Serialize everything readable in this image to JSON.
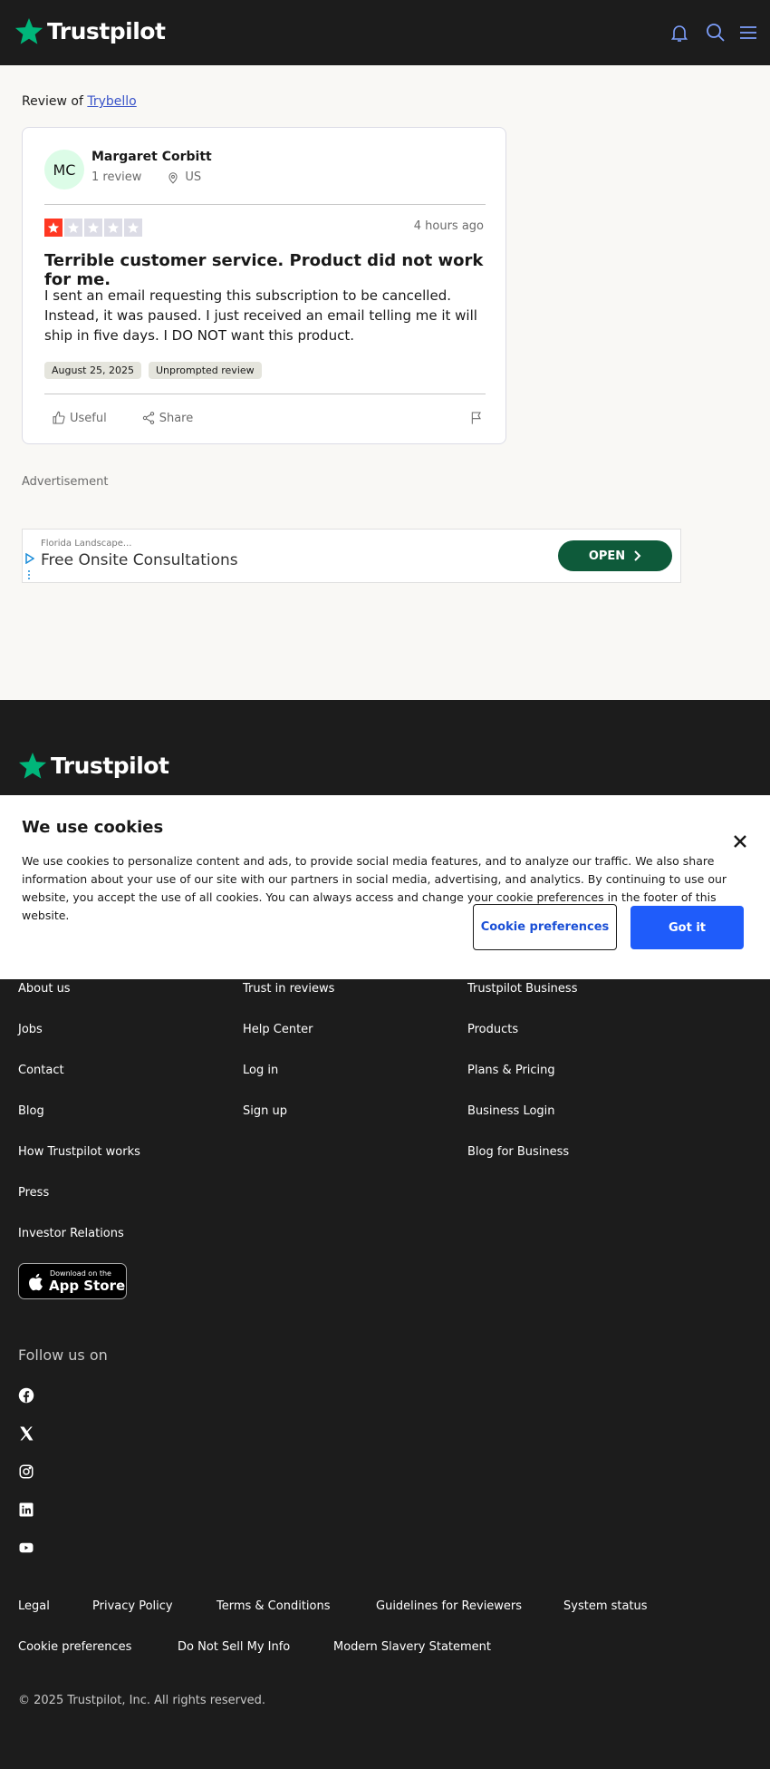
{
  "header": {
    "brand": "Trustpilot",
    "icons": [
      "bell-icon",
      "search-icon",
      "menu-icon"
    ]
  },
  "review_of": {
    "prefix": "Review of",
    "company": "Trybello"
  },
  "review": {
    "avatar_initials": "MC",
    "reviewer_name": "Margaret Corbitt",
    "review_count": "1 review",
    "country": "US",
    "rating": 1,
    "rating_max": 5,
    "time_ago": "4 hours ago",
    "title": "Terrible customer service. Product did not work for me.",
    "body": "I sent an email requesting this subscription to be cancelled. Instead, it was paused. I just received an email telling me it will ship in five days. I DO NOT want this product.",
    "date_tag": "August 25, 2025",
    "unprompted_tag": "Unprompted review",
    "useful_label": "Useful",
    "share_label": "Share"
  },
  "advertisement": {
    "label": "Advertisement",
    "advertiser": "Florida Landscape...",
    "headline": "Free Onsite Consultations",
    "cta": "OPEN"
  },
  "footer": {
    "brand": "Trustpilot",
    "col1": [
      "About us",
      "Jobs",
      "Contact",
      "Blog",
      "How Trustpilot works",
      "Press",
      "Investor Relations"
    ],
    "col2": [
      "Trust in reviews",
      "Help Center",
      "Log in",
      "Sign up"
    ],
    "col3": [
      "Trustpilot Business",
      "Products",
      "Plans & Pricing",
      "Business Login",
      "Blog for Business"
    ],
    "app_store_small": "Download on the",
    "app_store_big": "App Store",
    "follow_label": "Follow us on",
    "social": [
      "facebook-icon",
      "x-icon",
      "instagram-icon",
      "linkedin-icon",
      "youtube-icon"
    ],
    "bottom_row1": [
      "Legal",
      "Privacy Policy",
      "Terms & Conditions",
      "Guidelines for Reviewers",
      "System status"
    ],
    "bottom_row2": [
      "Cookie preferences",
      "Do Not Sell My Info",
      "Modern Slavery Statement"
    ],
    "copyright": "© 2025 Trustpilot, Inc. All rights reserved."
  },
  "cookie_banner": {
    "title": "We use cookies",
    "text": "We use cookies to personalize content and ads, to provide social media features, and to analyze our traffic. We also share information about your use of our site with our partners in social media, advertising, and analytics. By continuing to use our website, you accept the use of all cookies. You can always access and change your cookie preferences in the footer of this website.",
    "preferences_label": "Cookie preferences",
    "accept_label": "Got it"
  },
  "colors": {
    "brand_green": "#00b67a",
    "star_red": "#ff3722",
    "star_empty": "#dcdce6",
    "link_blue": "#3a54c9",
    "button_blue": "#1f5cfa",
    "footer_bg": "#1c1c1c"
  }
}
